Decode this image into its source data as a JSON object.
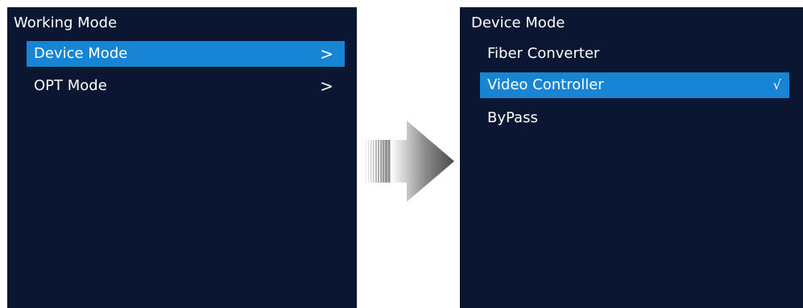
{
  "left_screen": {
    "title": "Working Mode",
    "items": [
      {
        "label": "Device Mode",
        "right": ">",
        "selected": true
      },
      {
        "label": "OPT Mode",
        "right": ">",
        "selected": false
      }
    ]
  },
  "right_screen": {
    "title": "Device Mode",
    "items": [
      {
        "label": "Fiber Converter",
        "selected": false
      },
      {
        "label": "Video Controller",
        "check": "√",
        "selected": true
      },
      {
        "label": "ByPass",
        "selected": false
      }
    ]
  },
  "colors": {
    "screen_background": "#0b1732",
    "highlight": "#1785d4",
    "text": "#ffffff"
  },
  "icons": {
    "transition": "arrow-right-icon",
    "submenu": "chevron-right",
    "checked": "checkmark"
  }
}
